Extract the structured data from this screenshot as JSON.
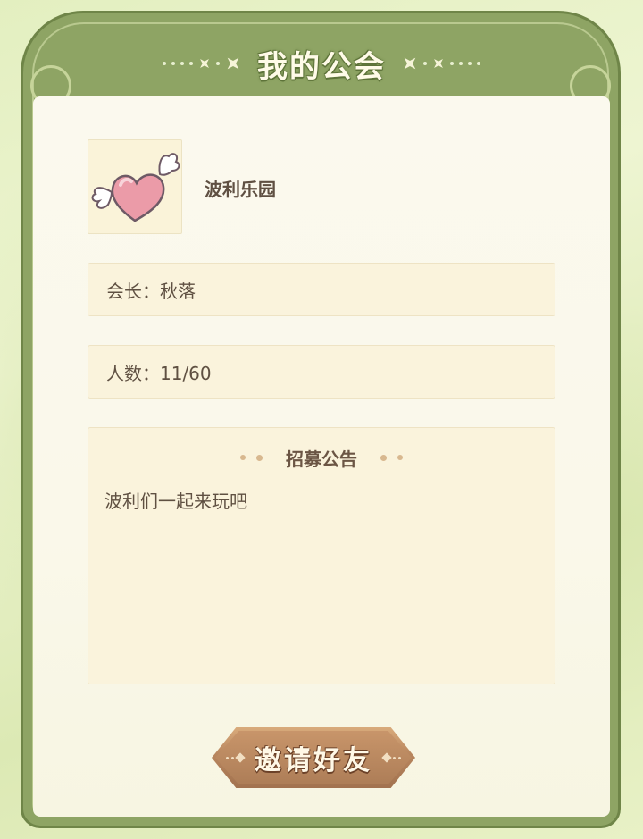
{
  "header": {
    "title": "我的公会"
  },
  "guild": {
    "name": "波利乐园",
    "leader_label": "会长：秋落",
    "members_label": "人数：11/60",
    "notice": {
      "heading": "招募公告",
      "text": "波利们一起来玩吧"
    },
    "avatar_icon": "winged-heart-icon"
  },
  "actions": {
    "invite_label": "邀请好友"
  },
  "colors": {
    "frame": "#8ea464",
    "panel": "#fbf9ee",
    "box": "#faf3dc",
    "text": "#5f5042",
    "button": "#b8865e"
  }
}
